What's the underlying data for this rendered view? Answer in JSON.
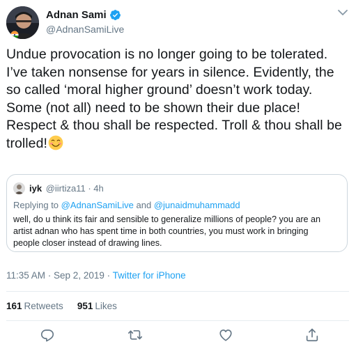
{
  "author": {
    "display_name": "Adnan Sami",
    "handle": "@AdnanSamiLive",
    "verified": true
  },
  "tweet": {
    "lines": [
      "Undue provocation is no longer going to be tolerated.",
      "I’ve taken nonsense for years in silence. Evidently, the",
      "so called ‘moral higher ground’ doesn’t work today.",
      "Some (not all) need to be shown their due place!",
      "Respect & thou shall be respected. Troll & thou shall be",
      "trolled!"
    ],
    "emoji": "smiling-face-emoji"
  },
  "quoted": {
    "name": "iyk",
    "handle_time": "@iirtiza11 · 4h",
    "replying_prefix": "Replying to ",
    "mention_1": "@AdnanSamiLive",
    "replying_and": " and ",
    "mention_2": "@junaidmuhammadd",
    "lines": [
      "well, do u think its fair and sensible to generalize millions of people? you are an",
      "artist adnan who has spent time in both countries, you must work in bringing",
      "people closer instead of drawing lines."
    ]
  },
  "meta": {
    "timestamp": "11:35 AM · Sep 2, 2019 · ",
    "source": "Twitter for iPhone"
  },
  "stats": {
    "retweets_count": "161",
    "retweets_label": "Retweets",
    "likes_count": "951",
    "likes_label": "Likes"
  },
  "colors": {
    "accent": "#1da1f2",
    "secondary_text": "#657786",
    "border": "#ccd6dd"
  }
}
